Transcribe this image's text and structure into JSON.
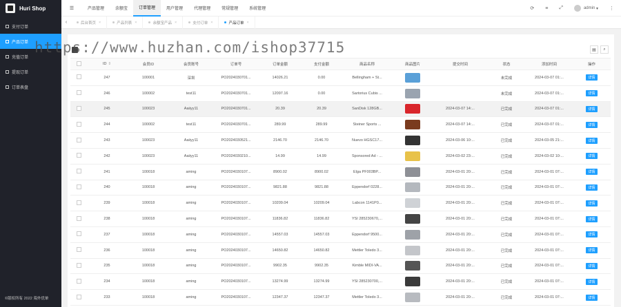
{
  "brand": {
    "title": "Huri Shop"
  },
  "sidebar": {
    "items": [
      {
        "label": "支付订单",
        "active": false
      },
      {
        "label": "产品订单",
        "active": true
      },
      {
        "label": "充值订单",
        "active": false
      },
      {
        "label": "提现订单",
        "active": false
      },
      {
        "label": "订单表盘",
        "active": false
      }
    ],
    "copyright": "©版权所有 2022 海外优单"
  },
  "topnav": {
    "items": [
      "产品管理",
      "余额宝",
      "订单管理",
      "用户管理",
      "代理管理",
      "常规管理",
      "系统管理"
    ],
    "active_index": 2,
    "user": "admin"
  },
  "tabs": [
    {
      "label": "后台首页",
      "active": false
    },
    {
      "label": "产品列表",
      "active": false
    },
    {
      "label": "余额宝产品",
      "active": false
    },
    {
      "label": "支付订单",
      "active": false
    },
    {
      "label": "产品订单",
      "active": true
    }
  ],
  "watermark": "https://www.huzhan.com/ishop37715",
  "table": {
    "columns": [
      "ID",
      "会员ID",
      "会员账号",
      "订单号",
      "订单金额",
      "支付金额",
      "商品名称",
      "商品图片",
      "提交时间",
      "状态",
      "添加时间",
      "操作"
    ],
    "action_label": "详情",
    "rows": [
      {
        "id": "247",
        "uid": "100001",
        "account": "深圳",
        "order_no": "PO2024030701...",
        "amount": "14026.21",
        "paid": "0.00",
        "name": "Bellingham + St...",
        "img_color": "#5aa0d8",
        "submit_time": "",
        "status": "未完成",
        "add_time": "2024-03-07 01:..."
      },
      {
        "id": "246",
        "uid": "100002",
        "account": "test11",
        "order_no": "PO2024030701...",
        "amount": "12097.16",
        "paid": "0.00",
        "name": "Sartorius Cubis ...",
        "img_color": "#9aa4b0",
        "submit_time": "",
        "status": "未完成",
        "add_time": "2024-03-07 01:..."
      },
      {
        "id": "245",
        "uid": "100023",
        "account": "Aaiiyy11",
        "order_no": "PO2024030701...",
        "amount": "20.39",
        "paid": "20.39",
        "name": "SanDisk 128GB...",
        "img_color": "#d9262c",
        "submit_time": "2024-03-07 14:...",
        "status": "已完成",
        "add_time": "2024-03-07 01:..."
      },
      {
        "id": "244",
        "uid": "100002",
        "account": "test11",
        "order_no": "PO2024030701...",
        "amount": "289.99",
        "paid": "289.99",
        "name": "Steiner Sports ...",
        "img_color": "#7a3b1e",
        "submit_time": "2024-03-07 14:...",
        "status": "已完成",
        "add_time": "2024-03-07 01:..."
      },
      {
        "id": "243",
        "uid": "100023",
        "account": "Aaiiyy11",
        "order_no": "PO2024030521...",
        "amount": "2146.70",
        "paid": "2146.70",
        "name": "Nuevo HGSC17...",
        "img_color": "#333333",
        "submit_time": "2024-03-06 10:...",
        "status": "已完成",
        "add_time": "2024-03-05 21:..."
      },
      {
        "id": "242",
        "uid": "100023",
        "account": "Aaiiyy11",
        "order_no": "PO2024030210...",
        "amount": "14.99",
        "paid": "14.99",
        "name": "Sponsored Ad - ...",
        "img_color": "#e8c24a",
        "submit_time": "2024-03-02 23:...",
        "status": "已完成",
        "add_time": "2024-03-02 10:..."
      },
      {
        "id": "241",
        "uid": "100018",
        "account": "aming",
        "order_no": "PO2024030107...",
        "amount": "8900.02",
        "paid": "8900.02",
        "name": "Elga PF003BP...",
        "img_color": "#8e9096",
        "submit_time": "2024-03-01 20:...",
        "status": "已完成",
        "add_time": "2024-03-01 07:..."
      },
      {
        "id": "240",
        "uid": "100018",
        "account": "aming",
        "order_no": "PO2024030107...",
        "amount": "9821.88",
        "paid": "9821.88",
        "name": "Eppendorf 0228...",
        "img_color": "#b4b8be",
        "submit_time": "2024-03-01 20:...",
        "status": "已完成",
        "add_time": "2024-03-01 07:..."
      },
      {
        "id": "239",
        "uid": "100018",
        "account": "aming",
        "order_no": "PO2024030107...",
        "amount": "10209.04",
        "paid": "10209.04",
        "name": "Labcon 1141P0...",
        "img_color": "#cfd2d6",
        "submit_time": "2024-03-01 20:...",
        "status": "已完成",
        "add_time": "2024-03-01 07:..."
      },
      {
        "id": "238",
        "uid": "100018",
        "account": "aming",
        "order_no": "PO2024030107...",
        "amount": "11836.82",
        "paid": "11836.82",
        "name": "YSI 285230670,...",
        "img_color": "#444444",
        "submit_time": "2024-03-01 20:...",
        "status": "已完成",
        "add_time": "2024-03-01 07:..."
      },
      {
        "id": "237",
        "uid": "100018",
        "account": "aming",
        "order_no": "PO2024030107...",
        "amount": "14557.03",
        "paid": "14557.03",
        "name": "Eppendorf 9500...",
        "img_color": "#9ea2a8",
        "submit_time": "2024-03-01 20:...",
        "status": "已完成",
        "add_time": "2024-03-01 07:..."
      },
      {
        "id": "236",
        "uid": "100018",
        "account": "aming",
        "order_no": "PO2024030107...",
        "amount": "14650.82",
        "paid": "14650.82",
        "name": "Mettler Toledo 3...",
        "img_color": "#c4c6ca",
        "submit_time": "2024-03-01 20:...",
        "status": "已完成",
        "add_time": "2024-03-01 07:..."
      },
      {
        "id": "235",
        "uid": "100018",
        "account": "aming",
        "order_no": "PO2024030107...",
        "amount": "9902.35",
        "paid": "9902.35",
        "name": "Kimble MIDI-VA...",
        "img_color": "#555555",
        "submit_time": "2024-03-01 20:...",
        "status": "已完成",
        "add_time": "2024-03-01 07:..."
      },
      {
        "id": "234",
        "uid": "100018",
        "account": "aming",
        "order_no": "PO2024030107...",
        "amount": "13274.99",
        "paid": "13274.99",
        "name": "YSI 285230700,...",
        "img_color": "#3a3a3a",
        "submit_time": "2024-03-01 20:...",
        "status": "已完成",
        "add_time": "2024-03-01 07:..."
      },
      {
        "id": "233",
        "uid": "100018",
        "account": "aming",
        "order_no": "PO2024030107...",
        "amount": "12347.37",
        "paid": "12347.37",
        "name": "Mettler Toledo 3...",
        "img_color": "#b8bbc0",
        "submit_time": "2024-03-01 20:...",
        "status": "已完成",
        "add_time": "2024-03-01 07:..."
      }
    ]
  }
}
